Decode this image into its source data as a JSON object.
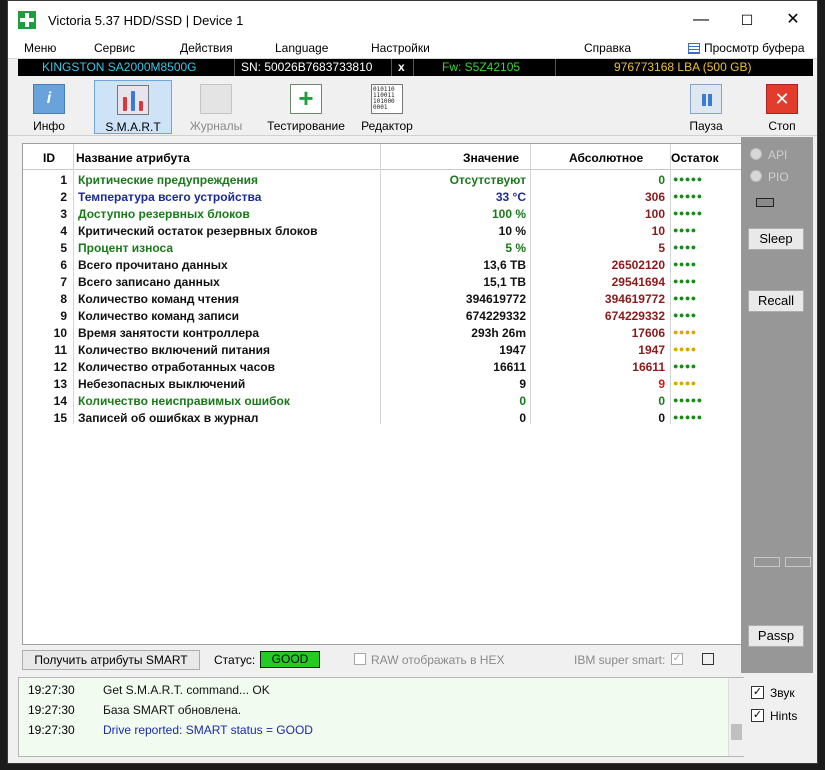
{
  "window": {
    "title": "Victoria 5.37 HDD/SSD | Device 1",
    "minimize": "—",
    "maximize": "☐",
    "close": "✕"
  },
  "menu": {
    "items": [
      "Меню",
      "Сервис",
      "Действия",
      "Language",
      "Настройки",
      "Справка"
    ],
    "buffer_label": "Просмотр буфера"
  },
  "device": {
    "model": "KINGSTON SA2000M8500G",
    "serial": "SN: 50026B7683733810",
    "x": "x",
    "firmware": "Fw: S5Z42105",
    "lba": "976773168 LBA (500 GB)"
  },
  "toolbar": {
    "info": "Инфо",
    "smart": "S.M.A.R.T",
    "logs": "Журналы",
    "testing": "Тестирование",
    "editor": "Редактор",
    "pause": "Пауза",
    "stop": "Стоп",
    "editor_icon_text": "010110 110011 101000 0001"
  },
  "table": {
    "headers": {
      "id": "ID",
      "name": "Название атрибута",
      "value": "Значение",
      "absolute": "Абсолютное",
      "remaining": "Остаток"
    },
    "rows": [
      {
        "id": "1",
        "name": "Критические предупреждения",
        "value": "Отсутствуют",
        "absolute": "0",
        "dots": "●●●●●",
        "name_color": "#1a7a1a",
        "value_color": "#1a7a1a",
        "abs_color": "#1a7a1a",
        "dot_color": "#1a8a1a"
      },
      {
        "id": "2",
        "name": "Температура всего устройства",
        "value": "33 °C",
        "absolute": "306",
        "dots": "●●●●●",
        "name_color": "#1a2a9a",
        "value_color": "#1a2a9a",
        "abs_color": "#8a1a1a",
        "dot_color": "#1a8a1a"
      },
      {
        "id": "3",
        "name": "Доступно резервных блоков",
        "value": "100 %",
        "absolute": "100",
        "dots": "●●●●●",
        "name_color": "#1a7a1a",
        "value_color": "#1a7a1a",
        "abs_color": "#8a1a1a",
        "dot_color": "#1a8a1a"
      },
      {
        "id": "4",
        "name": "Критический остаток резервных блоков",
        "value": "10 %",
        "absolute": "10",
        "dots": "●●●●",
        "name_color": "#111",
        "value_color": "#111",
        "abs_color": "#8a1a1a",
        "dot_color": "#1a8a1a"
      },
      {
        "id": "5",
        "name": "Процент износа",
        "value": "5 %",
        "absolute": "5",
        "dots": "●●●●",
        "name_color": "#1a7a1a",
        "value_color": "#1a7a1a",
        "abs_color": "#8a1a1a",
        "dot_color": "#1a8a1a"
      },
      {
        "id": "6",
        "name": "Всего прочитано данных",
        "value": "13,6 TB",
        "absolute": "26502120",
        "dots": "●●●●",
        "name_color": "#111",
        "value_color": "#111",
        "abs_color": "#8a1a1a",
        "dot_color": "#1a8a1a"
      },
      {
        "id": "7",
        "name": "Всего записано данных",
        "value": "15,1 TB",
        "absolute": "29541694",
        "dots": "●●●●",
        "name_color": "#111",
        "value_color": "#111",
        "abs_color": "#8a1a1a",
        "dot_color": "#1a8a1a"
      },
      {
        "id": "8",
        "name": "Количество команд чтения",
        "value": "394619772",
        "absolute": "394619772",
        "dots": "●●●●",
        "name_color": "#111",
        "value_color": "#111",
        "abs_color": "#8a1a1a",
        "dot_color": "#1a8a1a"
      },
      {
        "id": "9",
        "name": "Количество команд записи",
        "value": "674229332",
        "absolute": "674229332",
        "dots": "●●●●",
        "name_color": "#111",
        "value_color": "#111",
        "abs_color": "#8a1a1a",
        "dot_color": "#1a8a1a"
      },
      {
        "id": "10",
        "name": "Время занятости контроллера",
        "value": "293h 26m",
        "absolute": "17606",
        "dots": "●●●●",
        "name_color": "#111",
        "value_color": "#111",
        "abs_color": "#8a1a1a",
        "dot_color": "#d8a800"
      },
      {
        "id": "11",
        "name": "Количество включений питания",
        "value": "1947",
        "absolute": "1947",
        "dots": "●●●●",
        "name_color": "#111",
        "value_color": "#111",
        "abs_color": "#8a1a1a",
        "dot_color": "#d8a800"
      },
      {
        "id": "12",
        "name": "Количество отработанных часов",
        "value": "16611",
        "absolute": "16611",
        "dots": "●●●●",
        "name_color": "#111",
        "value_color": "#111",
        "abs_color": "#8a1a1a",
        "dot_color": "#1a8a1a"
      },
      {
        "id": "13",
        "name": "Небезопасных выключений",
        "value": "9",
        "absolute": "9",
        "dots": "●●●●",
        "name_color": "#111",
        "value_color": "#111",
        "abs_color": "#cc1a1a",
        "dot_color": "#d8a800"
      },
      {
        "id": "14",
        "name": "Количество неисправимых ошибок",
        "value": "0",
        "absolute": "0",
        "dots": "●●●●●",
        "name_color": "#1a7a1a",
        "value_color": "#1a7a1a",
        "abs_color": "#1a7a1a",
        "dot_color": "#1a8a1a"
      },
      {
        "id": "15",
        "name": "Записей об ошибках в журнал",
        "value": "0",
        "absolute": "0",
        "dots": "●●●●●",
        "name_color": "#111",
        "value_color": "#111",
        "abs_color": "#111",
        "dot_color": "#1a8a1a"
      }
    ]
  },
  "side": {
    "api": "API",
    "pio": "PIO",
    "sleep": "Sleep",
    "recall": "Recall",
    "passp": "Passp"
  },
  "bottom": {
    "get_smart": "Получить атрибуты SMART",
    "status_label": "Статус:",
    "status_value": "GOOD",
    "raw_hex": "RAW отображать в HEX",
    "ibm": "IBM super smart:"
  },
  "log": [
    {
      "time": "19:27:30",
      "msg": "Get S.M.A.R.T. command... OK",
      "color": "#111"
    },
    {
      "time": "19:27:30",
      "msg": "База SMART обновлена.",
      "color": "#111"
    },
    {
      "time": "19:27:30",
      "msg": "Drive reported: SMART status = GOOD",
      "color": "#1a2aa8"
    }
  ],
  "checks": {
    "sound": "Звук",
    "hints": "Hints",
    "checkmark": "✓"
  },
  "colors": {
    "status_good": "#22cc22",
    "device_model": "#39c7e8",
    "firmware": "#39d639",
    "lba": "#f0c030"
  }
}
